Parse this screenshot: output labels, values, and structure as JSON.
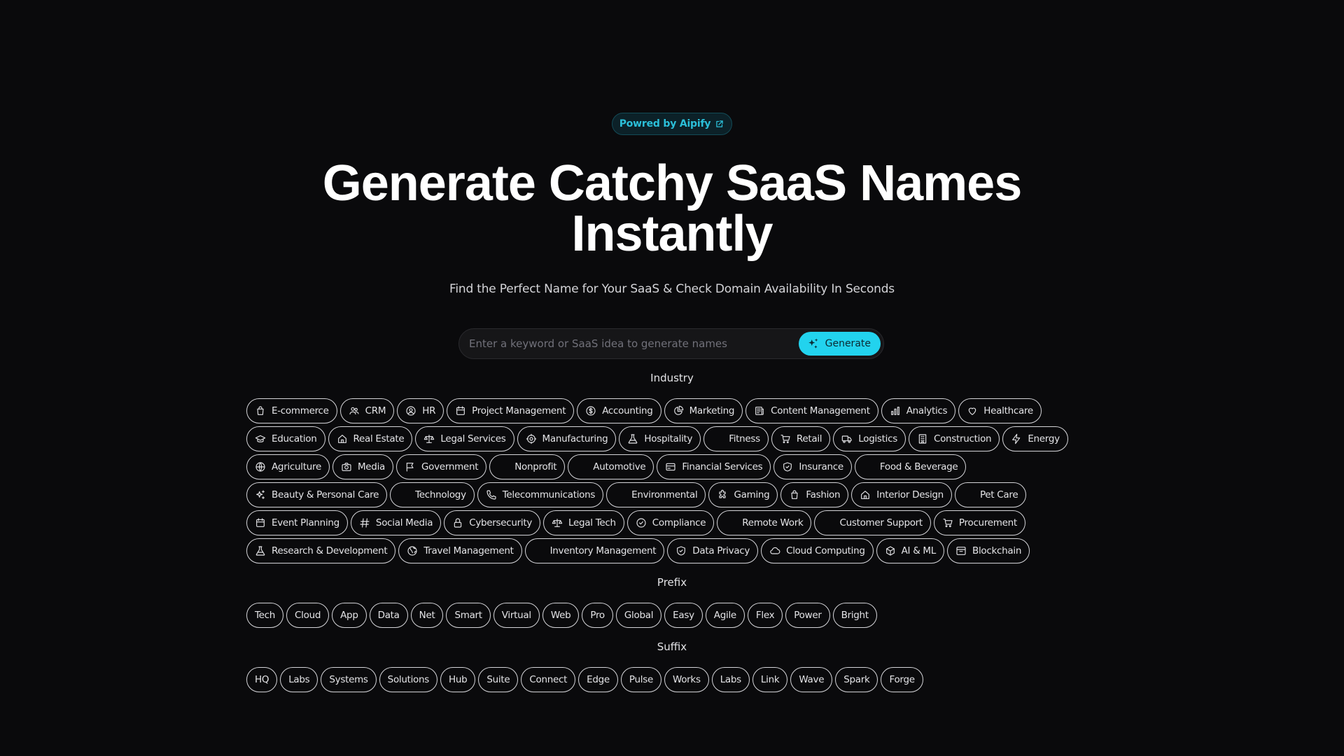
{
  "badge": {
    "label": "Powred by Aipify",
    "icon": "external-link-icon"
  },
  "hero": {
    "title_line1": "Generate Catchy SaaS Names",
    "title_line2": "Instantly",
    "subtitle": "Find the Perfect Name for Your SaaS & Check Domain Availability In Seconds"
  },
  "search": {
    "placeholder": "Enter a keyword or SaaS idea to generate names",
    "value": "",
    "button_label": "Generate",
    "button_icon": "sparkles-icon"
  },
  "colors": {
    "accent": "#22d3ee",
    "background": "#0a0a0c",
    "badge_text": "#2bbfd9"
  },
  "industry": {
    "label": "Industry",
    "items": [
      {
        "label": "E-commerce",
        "icon": "shopping-bag"
      },
      {
        "label": "CRM",
        "icon": "users"
      },
      {
        "label": "HR",
        "icon": "user-circle"
      },
      {
        "label": "Project Management",
        "icon": "calendar"
      },
      {
        "label": "Accounting",
        "icon": "dollar-circle"
      },
      {
        "label": "Marketing",
        "icon": "pie-chart"
      },
      {
        "label": "Content Management",
        "icon": "newspaper"
      },
      {
        "label": "Analytics",
        "icon": "bar-chart"
      },
      {
        "label": "Healthcare",
        "icon": "heart"
      },
      {
        "label": "Education",
        "icon": "graduation-cap"
      },
      {
        "label": "Real Estate",
        "icon": "home"
      },
      {
        "label": "Legal Services",
        "icon": "scale"
      },
      {
        "label": "Manufacturing",
        "icon": "cog"
      },
      {
        "label": "Hospitality",
        "icon": "flask"
      },
      {
        "label": "Fitness",
        "icon": ""
      },
      {
        "label": "Retail",
        "icon": "cart"
      },
      {
        "label": "Logistics",
        "icon": "truck"
      },
      {
        "label": "Construction",
        "icon": "building"
      },
      {
        "label": "Energy",
        "icon": "bolt"
      },
      {
        "label": "Agriculture",
        "icon": "globe"
      },
      {
        "label": "Media",
        "icon": "camera"
      },
      {
        "label": "Government",
        "icon": "flag"
      },
      {
        "label": "Nonprofit",
        "icon": ""
      },
      {
        "label": "Automotive",
        "icon": ""
      },
      {
        "label": "Financial Services",
        "icon": "credit-card"
      },
      {
        "label": "Insurance",
        "icon": "shield-check"
      },
      {
        "label": "Food & Beverage",
        "icon": ""
      },
      {
        "label": "Beauty & Personal Care",
        "icon": "sparkles"
      },
      {
        "label": "Technology",
        "icon": ""
      },
      {
        "label": "Telecommunications",
        "icon": "phone"
      },
      {
        "label": "Environmental",
        "icon": ""
      },
      {
        "label": "Gaming",
        "icon": "puzzle"
      },
      {
        "label": "Fashion",
        "icon": "shopping-bag"
      },
      {
        "label": "Interior Design",
        "icon": "home"
      },
      {
        "label": "Pet Care",
        "icon": ""
      },
      {
        "label": "Event Planning",
        "icon": "calendar"
      },
      {
        "label": "Social Media",
        "icon": "hashtag"
      },
      {
        "label": "Cybersecurity",
        "icon": "lock"
      },
      {
        "label": "Legal Tech",
        "icon": "scale"
      },
      {
        "label": "Compliance",
        "icon": "check-circle"
      },
      {
        "label": "Remote Work",
        "icon": ""
      },
      {
        "label": "Customer Support",
        "icon": ""
      },
      {
        "label": "Procurement",
        "icon": "cart"
      },
      {
        "label": "Research & Development",
        "icon": "flask"
      },
      {
        "label": "Travel Management",
        "icon": "globe-alt"
      },
      {
        "label": "Inventory Management",
        "icon": ""
      },
      {
        "label": "Data Privacy",
        "icon": "shield-check"
      },
      {
        "label": "Cloud Computing",
        "icon": "cloud"
      },
      {
        "label": "AI & ML",
        "icon": "cube"
      },
      {
        "label": "Blockchain",
        "icon": "archive"
      }
    ]
  },
  "prefix": {
    "label": "Prefix",
    "items": [
      "Tech",
      "Cloud",
      "App",
      "Data",
      "Net",
      "Smart",
      "Virtual",
      "Web",
      "Pro",
      "Global",
      "Easy",
      "Agile",
      "Flex",
      "Power",
      "Bright"
    ]
  },
  "suffix": {
    "label": "Suffix",
    "items": [
      "HQ",
      "Labs",
      "Systems",
      "Solutions",
      "Hub",
      "Suite",
      "Connect",
      "Edge",
      "Pulse",
      "Works",
      "Labs",
      "Link",
      "Wave",
      "Spark",
      "Forge"
    ]
  }
}
